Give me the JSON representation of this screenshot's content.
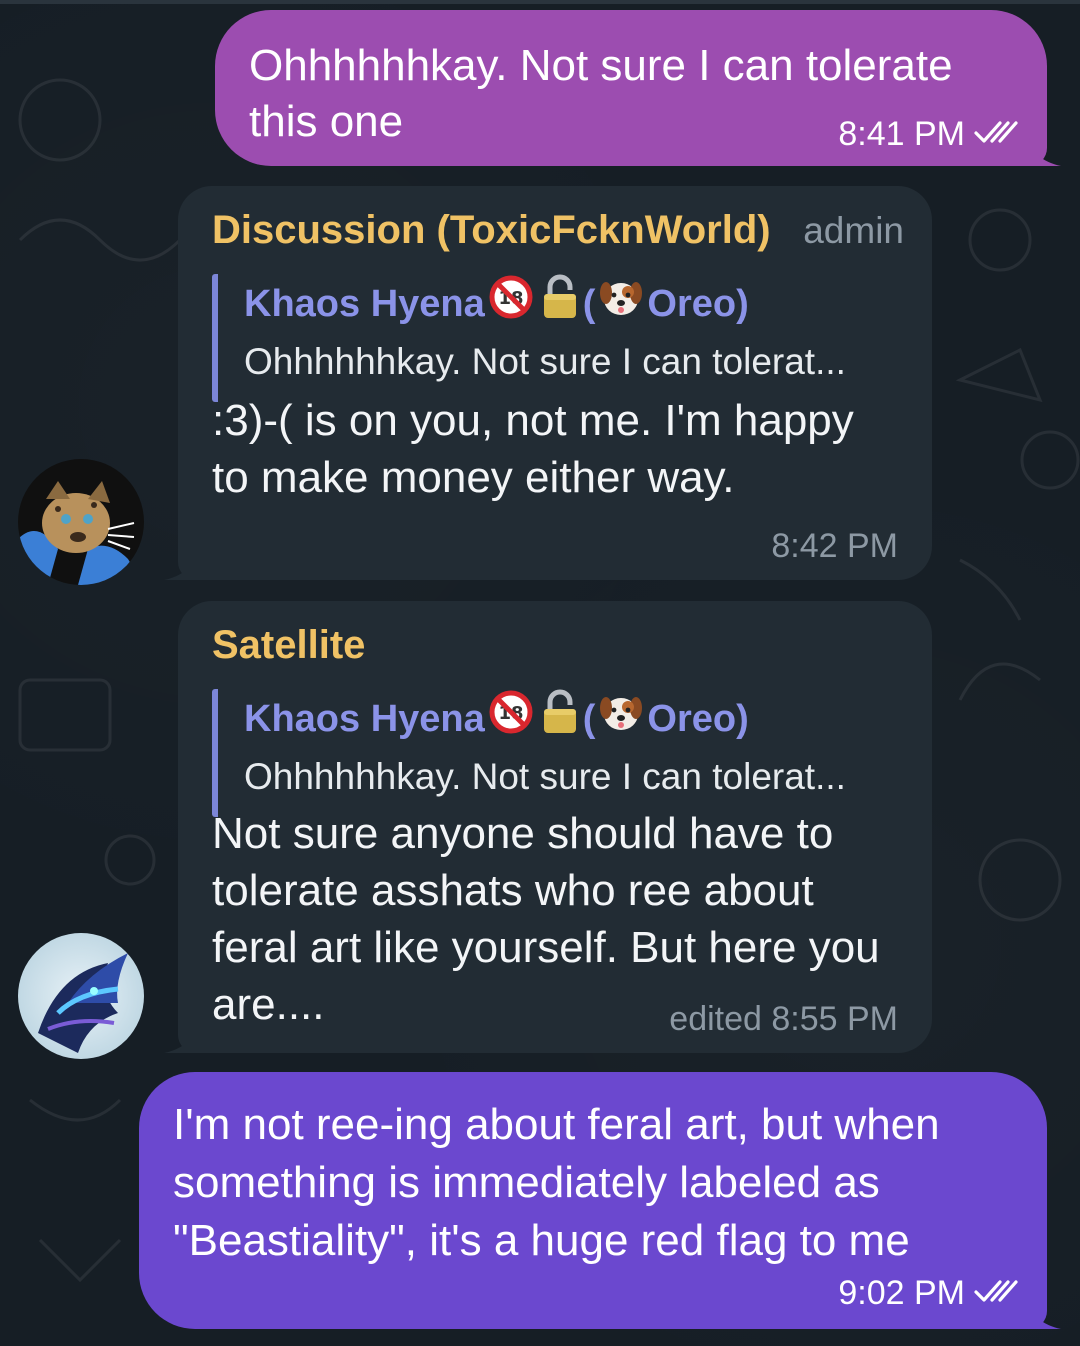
{
  "messages": {
    "out1": {
      "text": "Ohhhhhhkay. Not sure I can tolerate this one",
      "time": "8:41 PM",
      "status_icon": "double-check-icon"
    },
    "in1": {
      "sender": "Discussion (ToxicFcknWorld)",
      "role": "admin",
      "reply": {
        "name_prefix": "Khaos Hyena",
        "name_suffix_open": "(",
        "name_suffix": "Oreo)",
        "icons": [
          "no-one-under-18-icon",
          "lock-icon",
          "dog-face-icon"
        ],
        "text": "Ohhhhhhkay. Not sure I can tolerat..."
      },
      "text": ":3)-( is on you, not me. I'm happy to make money either way.",
      "time": "8:42 PM"
    },
    "in2": {
      "sender": "Satellite",
      "reply": {
        "name_prefix": "Khaos Hyena",
        "name_suffix_open": "(",
        "name_suffix": "Oreo)",
        "icons": [
          "no-one-under-18-icon",
          "lock-icon",
          "dog-face-icon"
        ],
        "text": "Ohhhhhhkay. Not sure I can tolerat..."
      },
      "text": "Not sure anyone should have to tolerate asshats who ree about feral art like yourself. But here you are....",
      "time": "edited 8:55 PM"
    },
    "out2": {
      "text": "I'm not ree-ing about feral art, but when something is immediately labeled as \"Beastiality\", it's a huge red flag to me",
      "time": "9:02 PM",
      "status_icon": "double-check-icon"
    }
  },
  "colors": {
    "background": "#161e25",
    "outgoing_1": "#9c4db0",
    "outgoing_2": "#6b48cf",
    "incoming": "#222c34",
    "sender_name": "#f0c265",
    "reply_name": "#8b93e8",
    "meta_gray": "#8d99a4"
  }
}
